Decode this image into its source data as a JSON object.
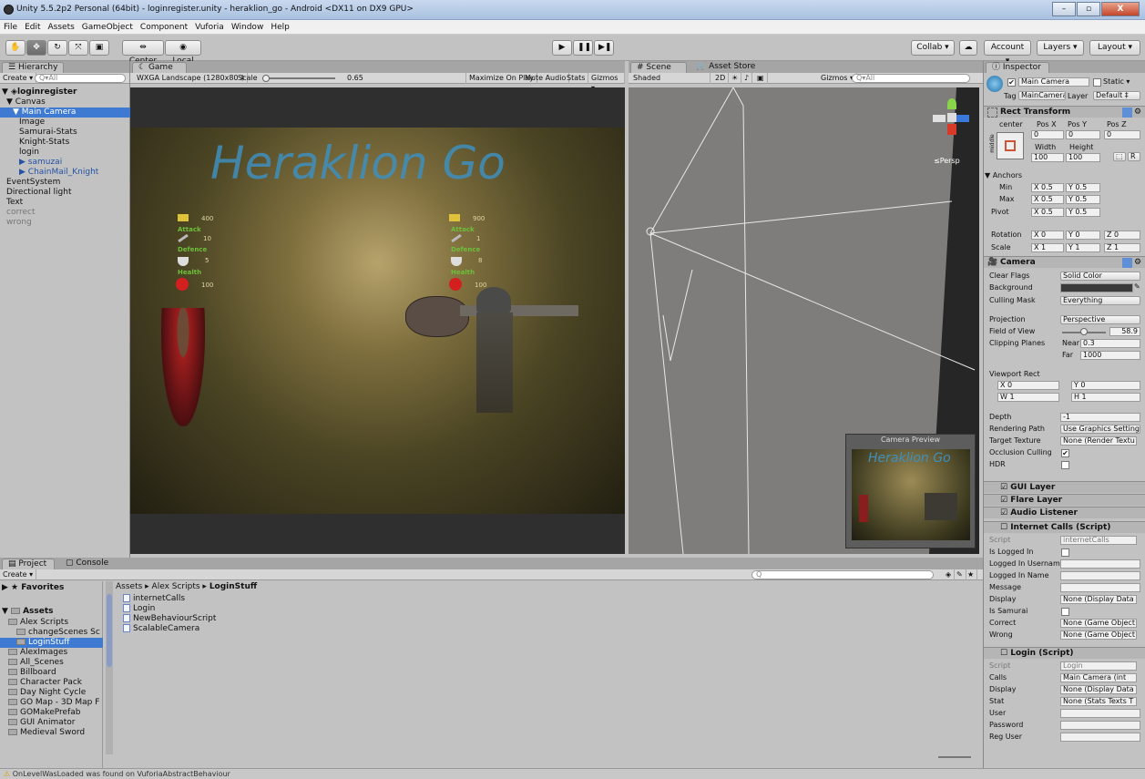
{
  "window": {
    "title": "Unity 5.5.2p2 Personal (64bit) - loginregister.unity - heraklion_go - Android <DX11 on DX9 GPU>",
    "buttons": [
      "–",
      "▫",
      "X"
    ]
  },
  "menu": [
    "File",
    "Edit",
    "Assets",
    "GameObject",
    "Component",
    "Vuforia",
    "Window",
    "Help"
  ],
  "toolbar": {
    "pivot": "Center",
    "space": "Local",
    "collab": "Collab ▾",
    "account": "Account ▾",
    "layers": "Layers ▾",
    "layout": "Layout ▾"
  },
  "hierarchy": {
    "tab": "Hierarchy",
    "create": "Create ▾",
    "search_placeholder": "Q▾All",
    "scene": "loginregister",
    "items": [
      {
        "label": "▼ Canvas",
        "indent": 1,
        "style": ""
      },
      {
        "label": "▼ Main Camera",
        "indent": 2,
        "style": "sel"
      },
      {
        "label": "Image",
        "indent": 3,
        "style": ""
      },
      {
        "label": "Samurai-Stats",
        "indent": 3,
        "style": ""
      },
      {
        "label": "Knight-Stats",
        "indent": 3,
        "style": ""
      },
      {
        "label": "login",
        "indent": 3,
        "style": ""
      },
      {
        "label": "▶ samuzai",
        "indent": 3,
        "style": "blue"
      },
      {
        "label": "▶ ChainMail_Knight",
        "indent": 3,
        "style": "blue"
      },
      {
        "label": "EventSystem",
        "indent": 1,
        "style": ""
      },
      {
        "label": "Directional light",
        "indent": 1,
        "style": ""
      },
      {
        "label": "Text",
        "indent": 1,
        "style": ""
      },
      {
        "label": "correct",
        "indent": 1,
        "style": "gray"
      },
      {
        "label": "wrong",
        "indent": 1,
        "style": "gray"
      }
    ]
  },
  "game": {
    "tab": "Game",
    "resolution": "WXGA Landscape (1280x80 ‡",
    "scale_label": "Scale",
    "scale_value": "0.65",
    "maximize": "Maximize On Play",
    "mute": "Mute Audio",
    "stats": "Stats",
    "gizmos": "Gizmos ▾",
    "title": "Heraklion Go",
    "left_stats": {
      "coins": "400",
      "attack_label": "Attack",
      "attack": "10",
      "defence_label": "Defence",
      "defence": "5",
      "health_label": "Health",
      "health": "100"
    },
    "right_stats": {
      "coins": "900",
      "attack_label": "Attack",
      "attack": "1",
      "defence_label": "Defence",
      "defence": "8",
      "health_label": "Health",
      "health": "100"
    }
  },
  "scene": {
    "tab": "Scene",
    "store_tab": "Asset Store",
    "shaded": "Shaded",
    "mode2d": "2D",
    "gizmos": "Gizmos ▾",
    "search_placeholder": "Q▾All",
    "persp": "≤Persp",
    "preview_title": "Camera Preview",
    "preview_game_title": "Heraklion Go"
  },
  "inspector": {
    "tab": "Inspector",
    "object_name": "Main Camera",
    "static": "Static ▾",
    "tag_label": "Tag",
    "tag": "MainCamera ‡",
    "layer_label": "Layer",
    "layer": "Default ‡",
    "rect": {
      "title": "Rect Transform",
      "anchor_mode": "center",
      "side_label": "middle",
      "posx_label": "Pos X",
      "posy_label": "Pos Y",
      "posz_label": "Pos Z",
      "posx": "0",
      "posy": "0",
      "posz": "0",
      "width_label": "Width",
      "height_label": "Height",
      "width": "100",
      "height": "100",
      "r": "R",
      "anchors": "▼ Anchors",
      "min": "Min",
      "max": "Max",
      "pivot": "Pivot",
      "min_x": "X 0.5",
      "min_y": "Y 0.5",
      "max_x": "X 0.5",
      "max_y": "Y 0.5",
      "pivot_x": "X 0.5",
      "pivot_y": "Y 0.5",
      "rotation": "Rotation",
      "scale": "Scale",
      "rot_x": "X 0",
      "rot_y": "Y 0",
      "rot_z": "Z 0",
      "sc_x": "X 1",
      "sc_y": "Y 1",
      "sc_z": "Z 1"
    },
    "camera": {
      "title": "Camera",
      "clear_flags": "Clear Flags",
      "clear_flags_v": "Solid Color",
      "background": "Background",
      "culling": "Culling Mask",
      "culling_v": "Everything",
      "projection": "Projection",
      "projection_v": "Perspective",
      "fov": "Field of View",
      "fov_v": "58.9",
      "clipping": "Clipping Planes",
      "near": "Near",
      "near_v": "0.3",
      "far": "Far",
      "far_v": "1000",
      "viewport": "Viewport Rect",
      "vx": "X 0",
      "vy": "Y 0",
      "vw": "W 1",
      "vh": "H 1",
      "depth": "Depth",
      "depth_v": "-1",
      "rendering": "Rendering Path",
      "rendering_v": "Use Graphics Settings ‡",
      "target": "Target Texture",
      "target_v": "None (Render Textu",
      "occlusion": "Occlusion Culling",
      "hdr": "HDR"
    },
    "gui_layer": "GUI Layer",
    "flare_layer": "Flare Layer",
    "audio_listener": "Audio Listener",
    "internet": {
      "title": "Internet Calls (Script)",
      "script": "Script",
      "script_v": "internetCalls",
      "logged_in": "Is Logged In",
      "logged_user": "Logged In Username",
      "logged_name": "Logged In Name",
      "message": "Message",
      "display": "Display",
      "display_v": "None (Display Data",
      "is_samurai": "Is Samurai",
      "correct": "Correct",
      "correct_v": "None (Game Object",
      "wrong": "Wrong",
      "wrong_v": "None (Game Object"
    },
    "login": {
      "title": "Login (Script)",
      "script": "Script",
      "script_v": "Login",
      "calls": "Calls",
      "calls_v": "Main Camera (int",
      "display": "Display",
      "display_v": "None (Display Data",
      "stat": "Stat",
      "stat_v": "None (Stats Texts T",
      "user": "User",
      "password": "Password",
      "req_user": "Reg User"
    }
  },
  "project": {
    "tab": "Project",
    "console_tab": "Console",
    "create": "Create ▾",
    "favorites": "Favorites",
    "assets": "Assets",
    "breadcrumb": [
      "Assets",
      "Alex Scripts",
      "LoginStuff"
    ],
    "tree": [
      {
        "label": "Alex Scripts",
        "indent": 1
      },
      {
        "label": "changeScenes Sc",
        "indent": 2
      },
      {
        "label": "LoginStuff",
        "indent": 2,
        "sel": true
      },
      {
        "label": "AlexImages",
        "indent": 1
      },
      {
        "label": "All_Scenes",
        "indent": 1
      },
      {
        "label": "Billboard",
        "indent": 1
      },
      {
        "label": "Character Pack",
        "indent": 1
      },
      {
        "label": "Day Night Cycle",
        "indent": 1
      },
      {
        "label": "GO Map - 3D Map F",
        "indent": 1
      },
      {
        "label": "GOMakePrefab",
        "indent": 1
      },
      {
        "label": "GUI Animator",
        "indent": 1
      },
      {
        "label": "Medieval Sword",
        "indent": 1
      }
    ],
    "files": [
      "internetCalls",
      "Login",
      "NewBehaviourScript",
      "ScalableCamera"
    ]
  },
  "status": "OnLevelWasLoaded was found on VuforiaAbstractBehaviour"
}
